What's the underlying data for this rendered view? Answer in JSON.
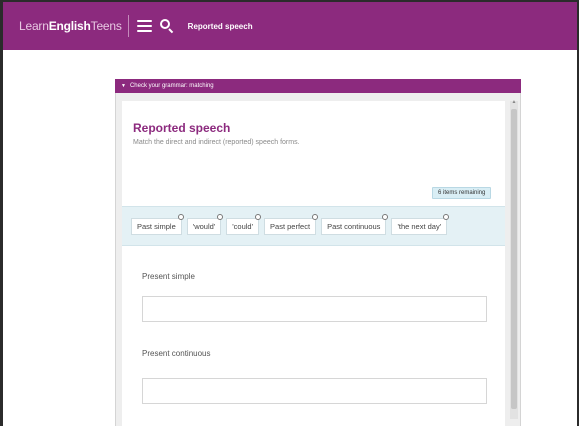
{
  "topbar": {
    "brand_learn": "Learn",
    "brand_english": "English",
    "brand_teens": " Teens",
    "breadcrumb": "Reported speech",
    "color": "#8c2a7e"
  },
  "panel": {
    "header": "Check your grammar: matching",
    "header_icon": "triangle-down-icon"
  },
  "exercise": {
    "title": "Reported speech",
    "instruction": "Match the direct and indirect (reported) speech forms.",
    "remaining": "6 items remaining",
    "chips": [
      {
        "label": "Past simple"
      },
      {
        "label": "'would'"
      },
      {
        "label": "'could'"
      },
      {
        "label": "Past perfect"
      },
      {
        "label": "Past continuous"
      },
      {
        "label": "'the next day'"
      }
    ],
    "targets": [
      {
        "label": "Present simple"
      },
      {
        "label": "Present continuous"
      }
    ]
  }
}
